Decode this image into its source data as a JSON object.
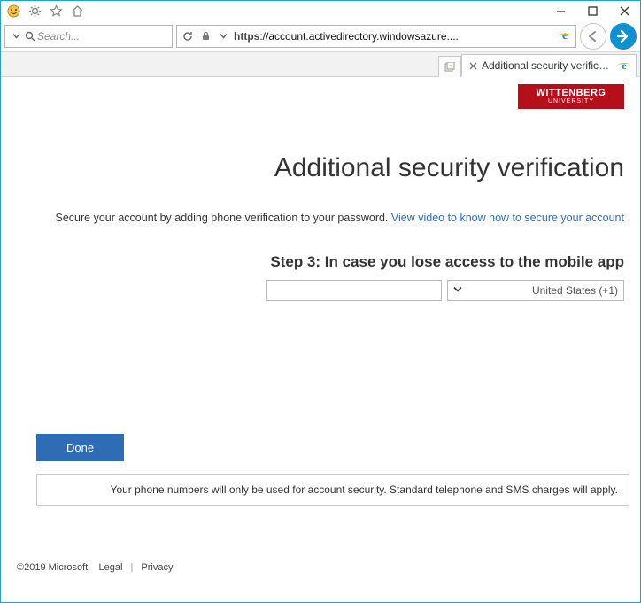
{
  "window": {
    "titlebar_icons": [
      "smiley-icon",
      "gear-icon",
      "star-icon",
      "home-icon"
    ]
  },
  "nav": {
    "url_scheme": "https",
    "url_display": "://account.activedirectory.windowsazure....",
    "search_placeholder": "Search..."
  },
  "tabs": {
    "active_title": "Additional security verificat..."
  },
  "brand": {
    "name": "WITTENBERG",
    "sub": "UNIVERSITY"
  },
  "page": {
    "heading": "Additional security verification",
    "desc_text": "Secure your account by adding phone verification to your password. ",
    "desc_link": "View video to know how to secure your account",
    "step_heading": "Step 3: In case you lose access to the mobile app",
    "country_selected": "United States (+1)",
    "done_label": "Done",
    "notice": "Your phone numbers will only be used for account security. Standard telephone and SMS charges will apply."
  },
  "footer": {
    "copyright": "©2019 Microsoft",
    "legal": "Legal",
    "privacy": "Privacy"
  }
}
